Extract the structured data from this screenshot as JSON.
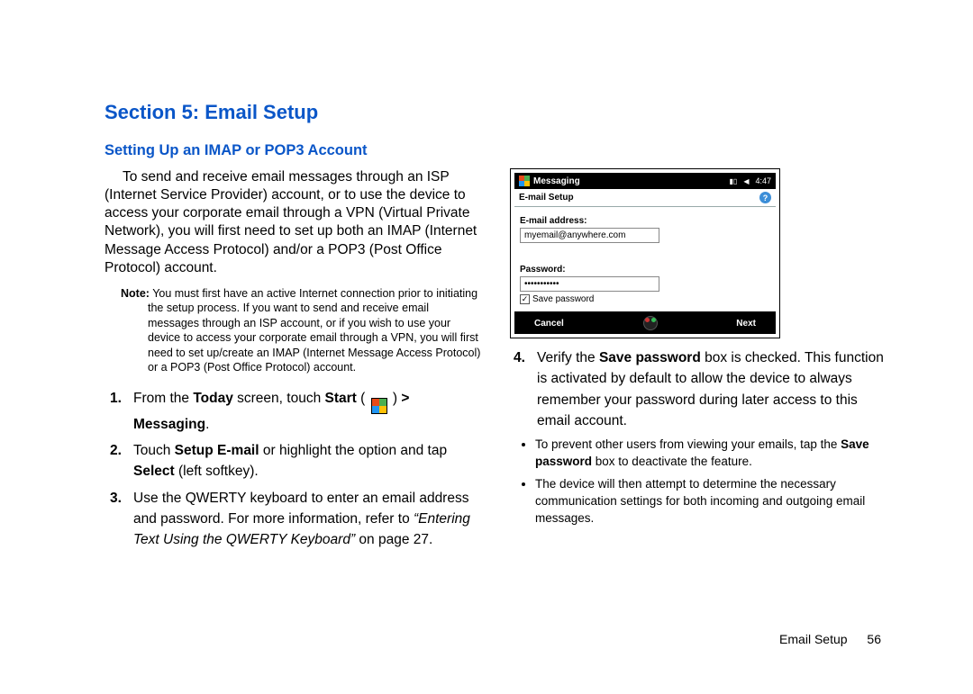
{
  "section_title": "Section 5: Email Setup",
  "sub_title": "Setting Up an IMAP or POP3 Account",
  "intro": "To send and receive email messages through an ISP (Internet Service Provider) account, or to use the device to access your corporate email through a VPN (Virtual Private Network), you will first need to set up both an IMAP (Internet Message Access Protocol) and/or a POP3 (Post Office Protocol) account.",
  "note_label": "Note:",
  "note": "You must first have an active Internet connection prior to initiating the setup process. If you want to send and receive email messages through an ISP account, or if you wish to use your device to access your corporate email through a VPN, you will first need to set up/create an IMAP (Internet Message Access Protocol) or a POP3 (Post Office Protocol) account.",
  "steps": {
    "s1a": "From the ",
    "s1today": "Today",
    "s1b": " screen, touch ",
    "s1start": "Start",
    "s1c": " ( ",
    "s1d": " ) ",
    "s1msg": "> Messaging",
    "s1e": ".",
    "s2a": "Touch ",
    "s2setup": "Setup E-mail",
    "s2b": " or highlight the option and tap ",
    "s2select": "Select",
    "s2c": " (left softkey).",
    "s3a": "Use the QWERTY keyboard to enter an email address and password. For more information, refer to ",
    "s3ref": "“Entering Text Using the QWERTY Keyboard”",
    "s3b": " on page 27.",
    "s4a": "Verify the ",
    "s4save": "Save password",
    "s4b": " box is checked. This function is activated by default to allow the device to always remember your password during later access to this email account."
  },
  "bullets": {
    "b1a": "To prevent other users from viewing your emails, tap the ",
    "b1save": "Save password",
    "b1b": " box to deactivate the feature.",
    "b2": "The device will then attempt to determine the necessary communication settings for both incoming and outgoing email messages."
  },
  "shot": {
    "app": "Messaging",
    "time": "4:47",
    "subheader": "E-mail Setup",
    "email_label": "E-mail address:",
    "email_value": "myemail@anywhere.com",
    "pw_label": "Password:",
    "pw_value": "•••••••••••",
    "save_pw": "Save password",
    "cancel": "Cancel",
    "next": "Next"
  },
  "footer": {
    "label": "Email Setup",
    "page": "56"
  }
}
